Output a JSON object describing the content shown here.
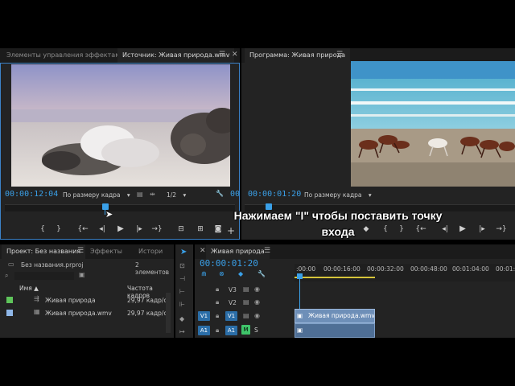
{
  "source_panel": {
    "tab_effects": "Элементы управления эффектами",
    "tab_source": "Источник: Живая природа.wmv",
    "timecode": "00:00:12:04",
    "fit_label": "По размеру кадра",
    "resolution": "1/2",
    "timecode_right": "00"
  },
  "program_panel": {
    "tab_label": "Программа: Живая природа",
    "timecode": "00:00:01:20",
    "fit_label": "По размеру кадра"
  },
  "caption": {
    "line1": "Нажимаем \"I\" чтобы поставить точку",
    "line2": "входа"
  },
  "project_panel": {
    "tab_project": "Проект: Без названия",
    "tab_effects": "Эффекты",
    "tab_history": "Истори",
    "file_name": "Без названия.prproj",
    "item_count": "2 элементов",
    "col_name": "Имя",
    "col_fps": "Частота кадров",
    "items": [
      {
        "name": "Живая природа",
        "fps": "29,97 кадр/с",
        "color": "#5ec45a",
        "icon": "sequence-icon"
      },
      {
        "name": "Живая природа.wmv",
        "fps": "29,97 кадр/с",
        "color": "#8fb7e8",
        "icon": "clip-icon"
      }
    ]
  },
  "timeline": {
    "tab_label": "Живая природа",
    "timecode": "00:00:01:20",
    "ruler": [
      ":00:00",
      "00:00:16:00",
      "00:00:32:00",
      "00:00:48:00",
      "00:01:04:00",
      "00:01:20"
    ],
    "tracks": {
      "v3": "V3",
      "v2": "V2",
      "v1_src": "V1",
      "v1": "V1",
      "a1_src": "A1",
      "a1": "A1",
      "m": "M",
      "s": "S"
    },
    "clip_video": "Живая природа.wmv [V]"
  },
  "colors": {
    "accent": "#3aa0e8",
    "panel": "#232323",
    "active_border": "#3c82c8",
    "clip_video": "#6e8fb8",
    "clip_audio": "#4f6f96"
  }
}
